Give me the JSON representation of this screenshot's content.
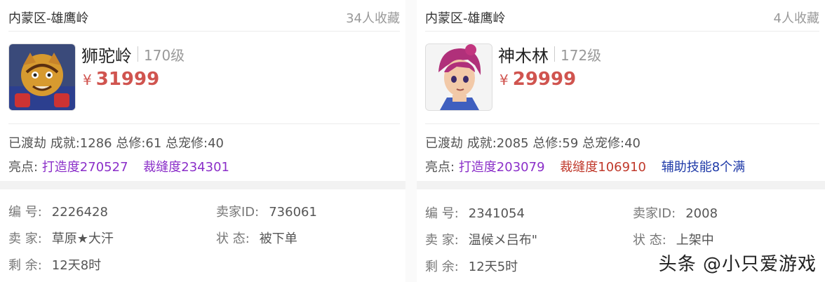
{
  "listings": [
    {
      "region": "内蒙区-雄鹰岭",
      "favorites": "34人收藏",
      "name": "狮驼岭",
      "level": "170级",
      "currency": "¥",
      "price": "31999",
      "stats": "已渡劫 成就:1286 总修:61 总宠修:40",
      "highlights_label": "亮点:",
      "highlights": [
        "打造度270527",
        "裁缝度234301"
      ],
      "highlight_colors": [
        "#8b2fc9",
        "#8b2fc9"
      ],
      "serial_key": "编 号:",
      "serial": "2226428",
      "seller_id_key": "卖家ID:",
      "seller_id": "736061",
      "seller_key": "卖 家:",
      "seller": "草原★大汗",
      "status_key": "状 态:",
      "status": "被下单",
      "remaining_key": "剩 余:",
      "remaining": "12天8时"
    },
    {
      "region": "内蒙区-雄鹰岭",
      "favorites": "4人收藏",
      "name": "神木林",
      "level": "172级",
      "currency": "¥",
      "price": "29999",
      "stats": "已渡劫 成就:2085 总修:59 总宠修:40",
      "highlights_label": "亮点:",
      "highlights": [
        "打造度203079",
        "裁缝度106910",
        "辅助技能8个满"
      ],
      "highlight_colors": [
        "#8b2fc9",
        "#c0392b",
        "#1f3aa8"
      ],
      "serial_key": "编 号:",
      "serial": "2341054",
      "seller_id_key": "卖家ID:",
      "seller_id": "2008",
      "seller_key": "卖 家:",
      "seller": "温候メ吕布\"",
      "status_key": "状 态:",
      "status": "上架中",
      "remaining_key": "剩 余:",
      "remaining": "12天5时"
    }
  ],
  "watermark": "头条 @小只爱游戏"
}
